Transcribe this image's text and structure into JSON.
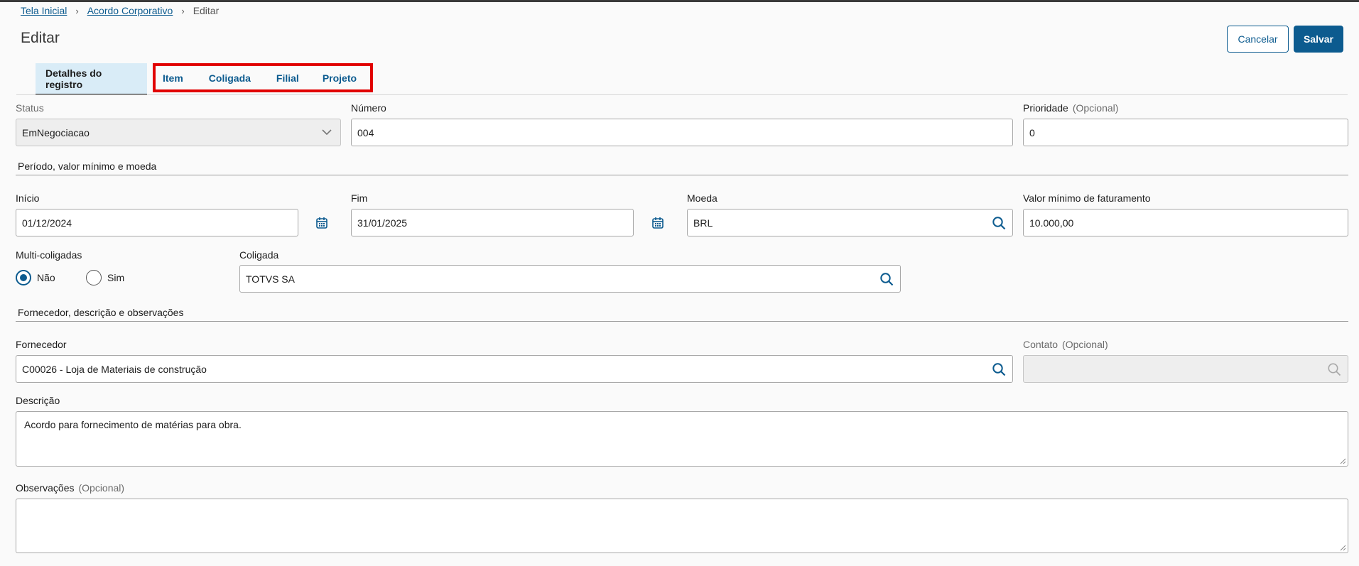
{
  "breadcrumb": {
    "home": "Tela Inicial",
    "parent": "Acordo Corporativo",
    "current": "Editar"
  },
  "page": {
    "title": "Editar"
  },
  "actions": {
    "cancel": "Cancelar",
    "save": "Salvar"
  },
  "tabs": [
    {
      "label": "Detalhes do registro",
      "active": true
    },
    {
      "label": "Item"
    },
    {
      "label": "Coligada"
    },
    {
      "label": "Filial"
    },
    {
      "label": "Projeto"
    }
  ],
  "fields": {
    "status": {
      "label": "Status",
      "value": "EmNegociacao"
    },
    "numero": {
      "label": "Número",
      "value": "004"
    },
    "prioridade": {
      "label": "Prioridade",
      "optional": "(Opcional)",
      "value": "0"
    },
    "inicio": {
      "label": "Início",
      "value": "01/12/2024"
    },
    "fim": {
      "label": "Fim",
      "value": "31/01/2025"
    },
    "moeda": {
      "label": "Moeda",
      "value": "BRL"
    },
    "valor_minimo": {
      "label": "Valor mínimo de faturamento",
      "value": "10.000,00"
    },
    "multi_coligadas": {
      "label": "Multi-coligadas",
      "options": [
        "Não",
        "Sim"
      ],
      "selected": "Não"
    },
    "coligada": {
      "label": "Coligada",
      "value": "TOTVS SA"
    },
    "fornecedor": {
      "label": "Fornecedor",
      "value": "C00026 - Loja de Materiais de construção"
    },
    "contato": {
      "label": "Contato",
      "optional": "(Opcional)",
      "value": ""
    },
    "descricao": {
      "label": "Descrição",
      "value": "Acordo para fornecimento de matérias para obra."
    },
    "observacoes": {
      "label": "Observações",
      "optional": "(Opcional)",
      "value": ""
    }
  },
  "sections": {
    "periodo": "Período, valor mínimo e moeda",
    "fornecedor": "Fornecedor, descrição e observações"
  },
  "colors": {
    "primary": "#0c5b8f",
    "active_tab_bg": "#d9ecf7",
    "highlight": "#e10000"
  },
  "icons": [
    "chevron-right-icon",
    "chevron-down-icon",
    "calendar-icon",
    "search-icon"
  ]
}
